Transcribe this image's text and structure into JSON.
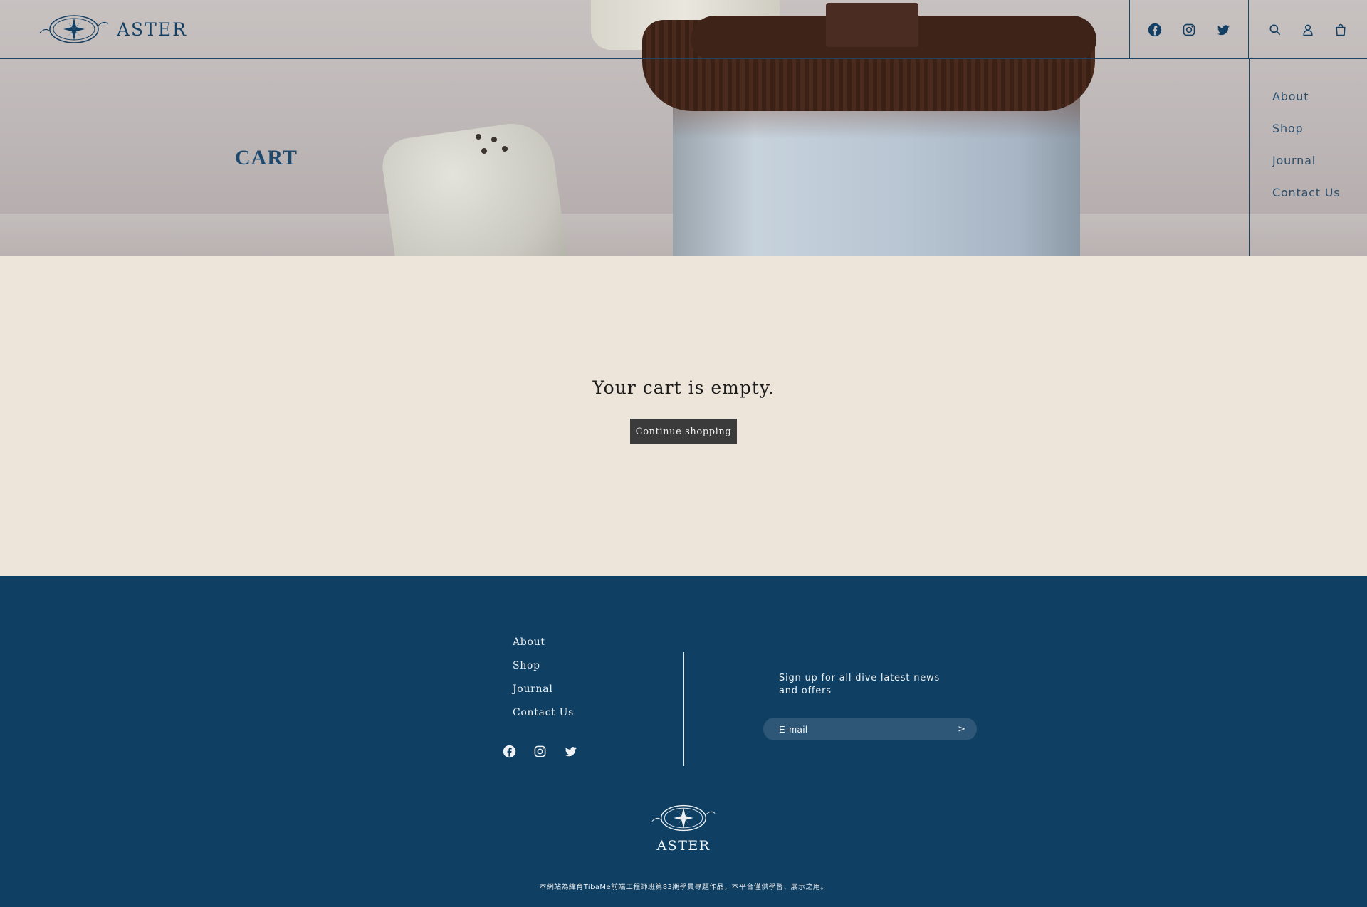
{
  "brand": {
    "name": "ASTER"
  },
  "colors": {
    "primary": "#0f3f62",
    "background": "#ede5da",
    "button": "#3b3b3b",
    "link": "#2d4e6a"
  },
  "header": {
    "social_icons": [
      "facebook-icon",
      "instagram-icon",
      "twitter-icon"
    ],
    "tool_icons": [
      "search-icon",
      "account-icon",
      "cart-icon"
    ]
  },
  "side_nav": {
    "items": [
      {
        "label": "About"
      },
      {
        "label": "Shop"
      },
      {
        "label": "Journal"
      },
      {
        "label": "Contact Us"
      }
    ]
  },
  "hero": {
    "title": "CART"
  },
  "cart": {
    "empty_message": "Your cart is empty.",
    "continue_label": "Continue shopping"
  },
  "footer": {
    "nav": [
      {
        "label": "About"
      },
      {
        "label": "Shop"
      },
      {
        "label": "Journal"
      },
      {
        "label": "Contact Us"
      }
    ],
    "signup_text": "Sign up for all dive latest news and offers",
    "email_placeholder": "E-mail",
    "submit_glyph": ">",
    "brand": "ASTER",
    "note": "本網站為緯育TibaMe前端工程師班第83期學員專題作品，本平台僅供學習、展示之用。"
  }
}
